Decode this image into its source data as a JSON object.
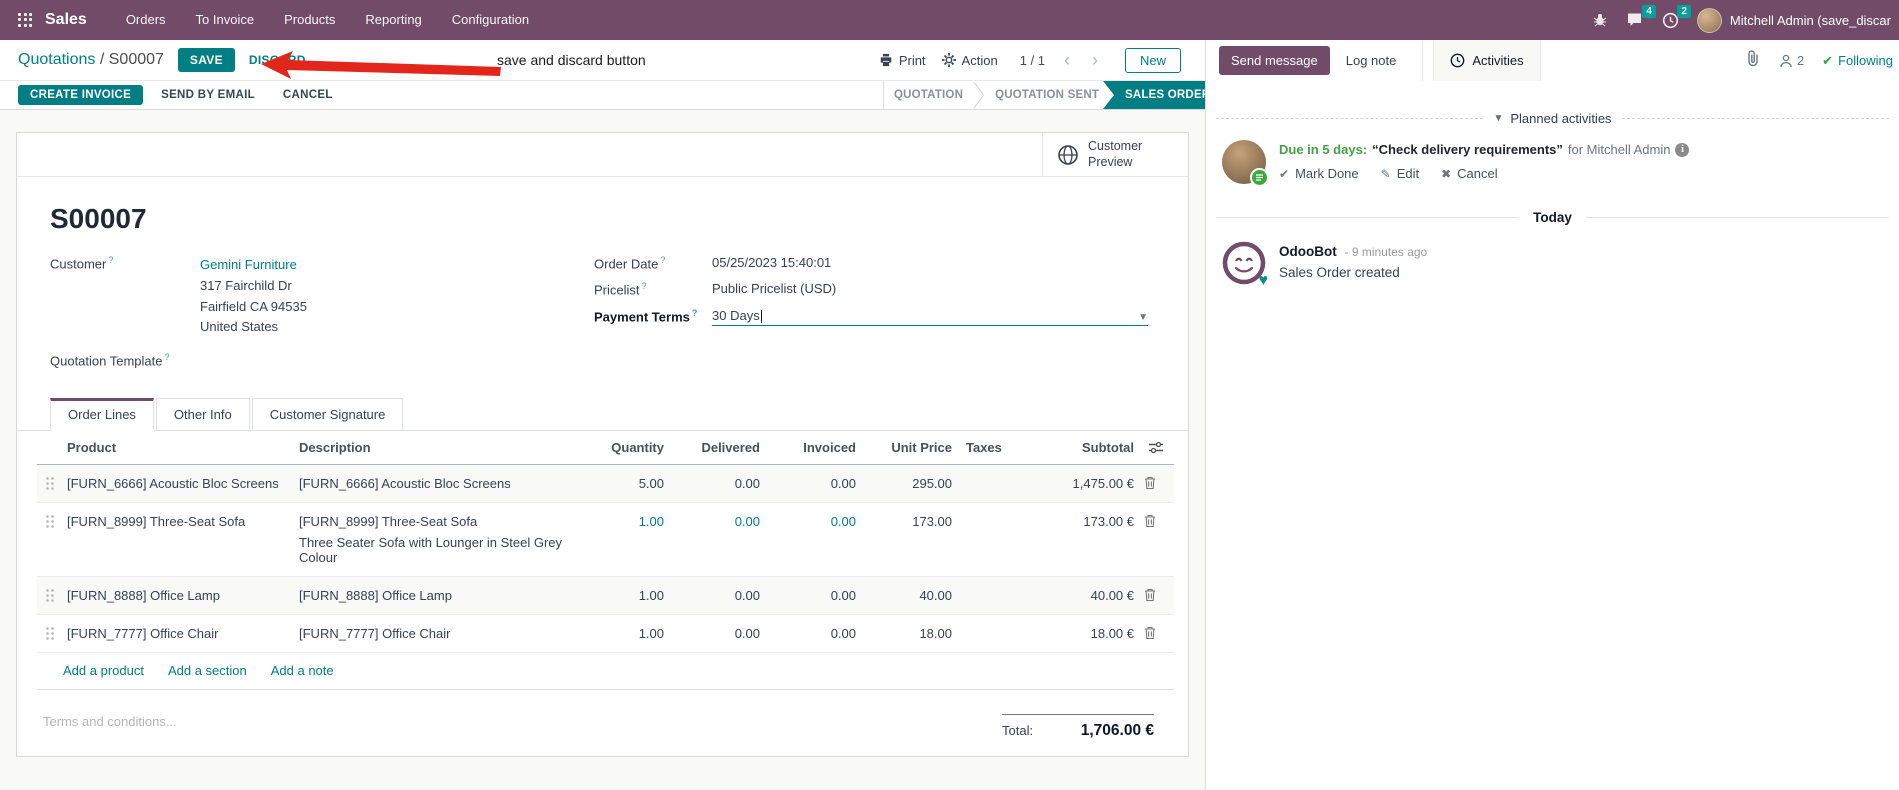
{
  "nav": {
    "app_label": "Sales",
    "items": [
      "Orders",
      "To Invoice",
      "Products",
      "Reporting",
      "Configuration"
    ],
    "messages_badge": "4",
    "activities_badge": "2",
    "user_name": "Mitchell Admin (save_discar"
  },
  "control": {
    "breadcrumb_parent": "Quotations",
    "breadcrumb_sep": "/",
    "breadcrumb_current": "S00007",
    "save": "SAVE",
    "discard": "DISCARD",
    "annotation": "save and discard button",
    "print": "Print",
    "action": "Action",
    "pager": "1 / 1",
    "new": "New"
  },
  "status_buttons": {
    "create_invoice": "CREATE INVOICE",
    "send_by_email": "SEND BY EMAIL",
    "cancel": "CANCEL"
  },
  "statusbar": {
    "steps": [
      "QUOTATION",
      "QUOTATION SENT",
      "SALES ORDER"
    ],
    "active_step": "SALES ORDER"
  },
  "sheet": {
    "preview_button": "Customer Preview",
    "doc_name": "S00007",
    "help_marker": "?",
    "customer": {
      "label": "Customer",
      "name": "Gemini Furniture",
      "address": [
        "317 Fairchild Dr",
        "Fairfield CA 94535",
        "United States"
      ]
    },
    "quotation_template_label": "Quotation Template",
    "order_date": {
      "label": "Order Date",
      "value": "05/25/2023 15:40:01"
    },
    "pricelist": {
      "label": "Pricelist",
      "value": "Public Pricelist (USD)"
    },
    "payment_terms": {
      "label": "Payment Terms",
      "value": "30 Days"
    },
    "tabs": [
      "Order Lines",
      "Other Info",
      "Customer Signature"
    ],
    "table": {
      "headers": {
        "product": "Product",
        "description": "Description",
        "quantity": "Quantity",
        "delivered": "Delivered",
        "invoiced": "Invoiced",
        "unit_price": "Unit Price",
        "taxes": "Taxes",
        "subtotal": "Subtotal"
      },
      "rows": [
        {
          "product": "[FURN_6666] Acoustic Bloc Screens",
          "description": "[FURN_6666] Acoustic Bloc Screens",
          "quantity": "5.00",
          "delivered": "0.00",
          "invoiced": "0.00",
          "unit_price": "295.00",
          "taxes": "",
          "subtotal": "1,475.00 €"
        },
        {
          "product": "[FURN_8999] Three-Seat Sofa",
          "description": "[FURN_8999] Three-Seat Sofa",
          "description2": "Three Seater Sofa with Lounger in Steel Grey Colour",
          "quantity": "1.00",
          "delivered": "0.00",
          "invoiced": "0.00",
          "unit_price": "173.00",
          "taxes": "",
          "subtotal": "173.00 €"
        },
        {
          "product": "[FURN_8888] Office Lamp",
          "description": "[FURN_8888] Office Lamp",
          "quantity": "1.00",
          "delivered": "0.00",
          "invoiced": "0.00",
          "unit_price": "40.00",
          "taxes": "",
          "subtotal": "40.00 €"
        },
        {
          "product": "[FURN_7777] Office Chair",
          "description": "[FURN_7777] Office Chair",
          "quantity": "1.00",
          "delivered": "0.00",
          "invoiced": "0.00",
          "unit_price": "18.00",
          "taxes": "",
          "subtotal": "18.00 €"
        }
      ],
      "links": [
        "Add a product",
        "Add a section",
        "Add a note"
      ],
      "terms_placeholder": "Terms and conditions...",
      "total_label": "Total:",
      "total_value": "1,706.00 €"
    }
  },
  "chatter": {
    "send_message": "Send message",
    "log_note": "Log note",
    "activities": "Activities",
    "followers_count": "2",
    "following": "Following",
    "planned_title": "Planned activities",
    "activity": {
      "due": "Due in 5 days:",
      "summary": "“Check delivery requirements”",
      "assignee": "for Mitchell Admin",
      "mark_done": "Mark Done",
      "edit": "Edit",
      "cancel": "Cancel"
    },
    "today": "Today",
    "message": {
      "author": "OdooBot",
      "time": "- 9 minutes ago",
      "body": "Sales Order created"
    }
  },
  "colors": {
    "brand_purple": "#714B67",
    "primary_teal": "#017E84",
    "badge_teal": "#00A09D",
    "success_green": "#28a745",
    "annotation_arrow_red": "#e3261b"
  }
}
